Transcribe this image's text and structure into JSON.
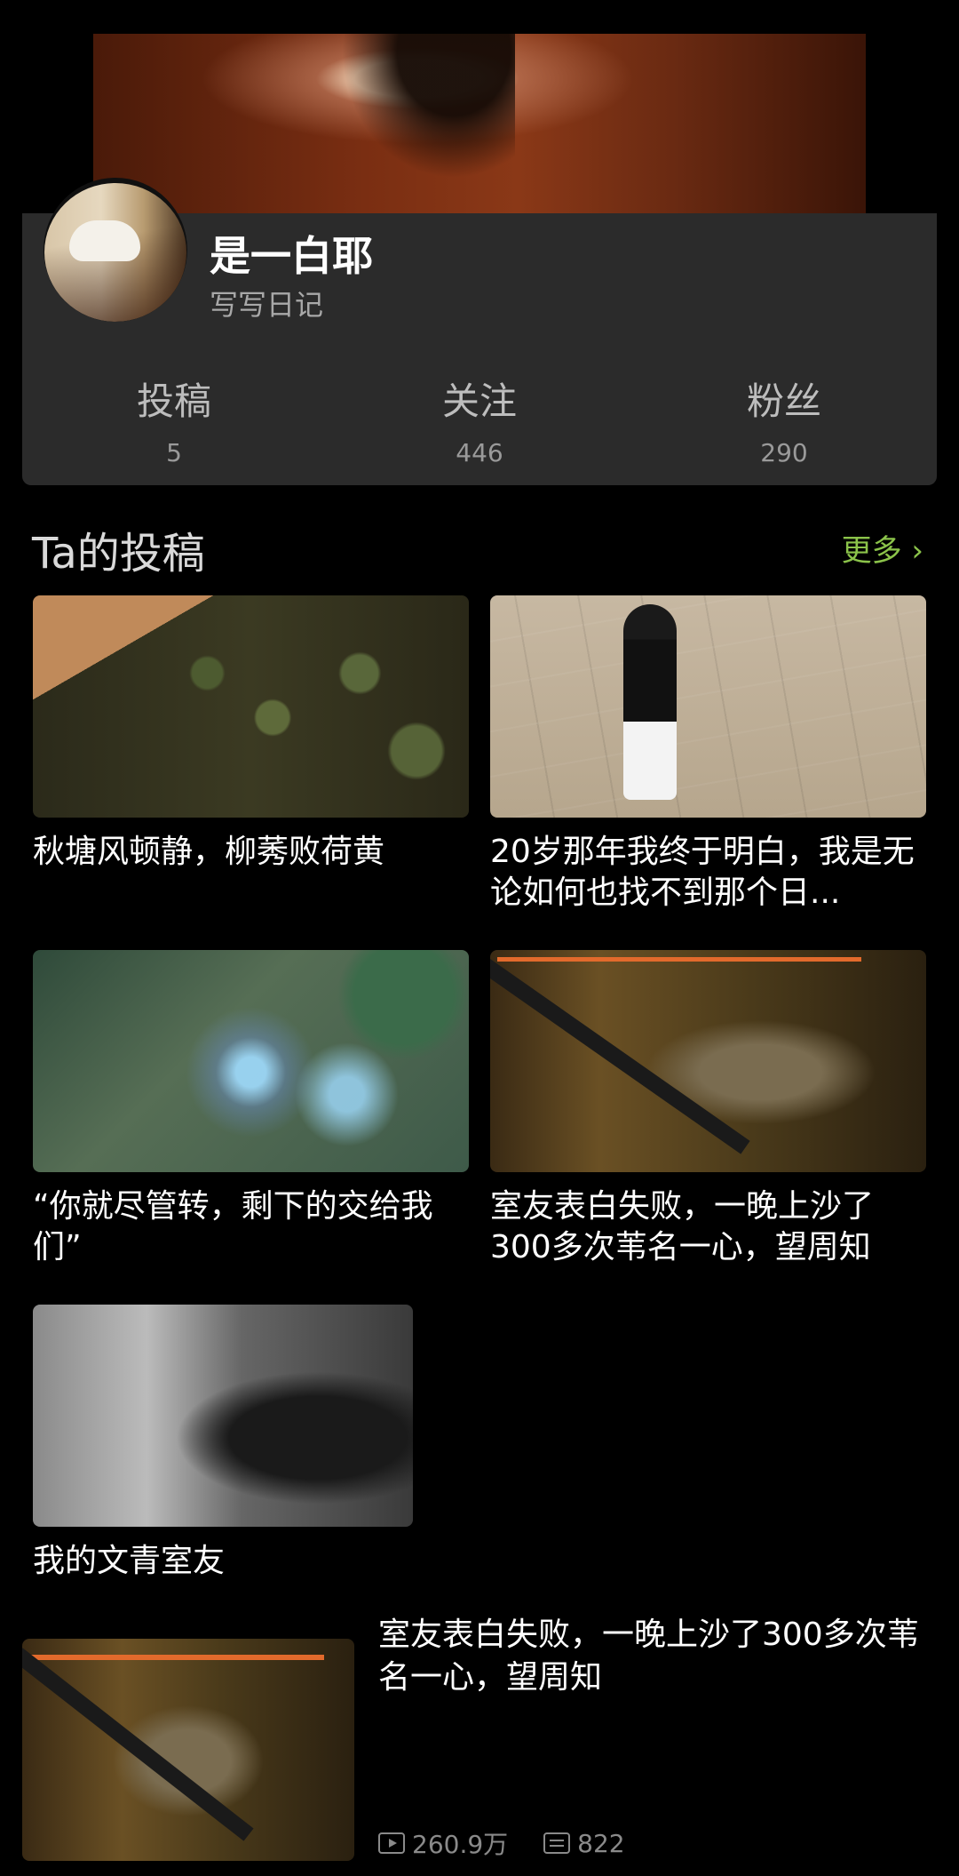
{
  "profile": {
    "name": "是一白耶",
    "bio": "写写日记",
    "stats": [
      {
        "label": "投稿",
        "value": "5"
      },
      {
        "label": "关注",
        "value": "446"
      },
      {
        "label": "粉丝",
        "value": "290"
      }
    ]
  },
  "section": {
    "title": "Ta的投稿",
    "more": "更多 ›"
  },
  "posts": [
    {
      "title": "秋塘风顿静，柳莠败荷黄"
    },
    {
      "title": "20岁那年我终于明白，我是无论如何也找不到那个日..."
    },
    {
      "title": "“你就尽管转，剩下的交给我们”"
    },
    {
      "title": "室友表白失败，一晚上沙了300多次苇名一心，望周知"
    },
    {
      "title": "我的文青室友"
    }
  ],
  "feed_item": {
    "title": "室友表白失败，一晚上沙了300多次苇名一心，望周知",
    "views": "260.9万",
    "comments": "822"
  },
  "icons": [
    "play-icon",
    "comment-icon",
    "chevron-right-icon"
  ],
  "colors": {
    "accent": "#8bc34a",
    "card_bg": "#2b2b2b",
    "page_bg": "#000000"
  }
}
